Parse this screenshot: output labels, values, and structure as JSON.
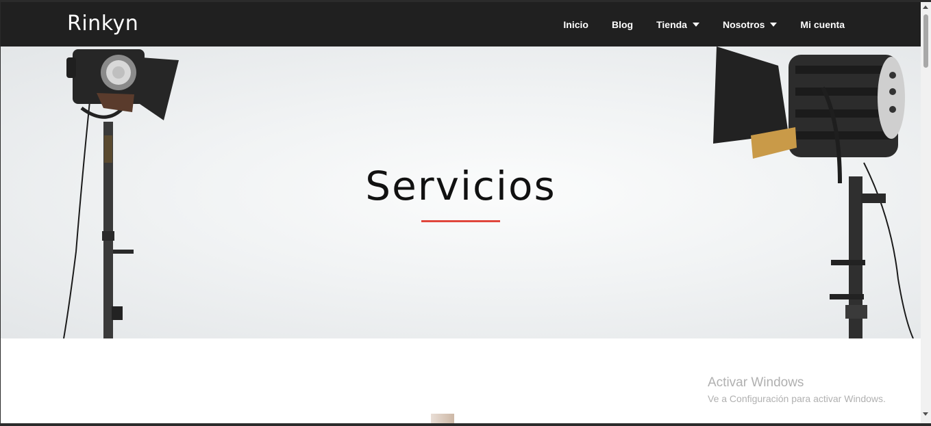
{
  "header": {
    "brand": "Rinkyn",
    "nav": [
      {
        "label": "Inicio",
        "dropdown": false
      },
      {
        "label": "Blog",
        "dropdown": false
      },
      {
        "label": "Tienda",
        "dropdown": true
      },
      {
        "label": "Nosotros",
        "dropdown": true
      },
      {
        "label": "Mi cuenta",
        "dropdown": false
      }
    ]
  },
  "hero": {
    "title": "Servicios",
    "accent_color": "#e0463c"
  },
  "watermark": {
    "title": "Activar Windows",
    "subtitle": "Ve a Configuración para activar Windows."
  }
}
